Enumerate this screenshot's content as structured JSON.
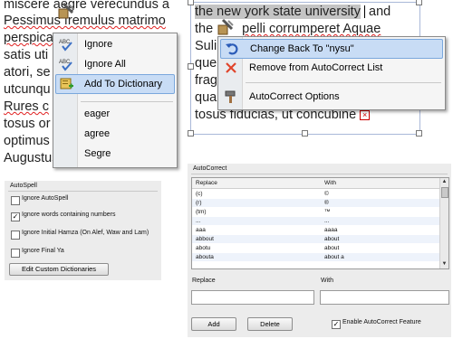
{
  "document_left": {
    "lines": [
      "miscere aegre verecundus a",
      "Pessimus fremulus matrimo",
      "perspica",
      "satis uti",
      "atori, se",
      "utcunqu",
      "Rures c",
      "tosus or",
      "optimus",
      "Augustus"
    ]
  },
  "document_right": {
    "line1": "the new york state university",
    "line1_end": "and",
    "line2": "the",
    "line2_end": "pelli corrumperet Aquae",
    "partial_lines": [
      "Suli",
      "que",
      "frag",
      "qua"
    ],
    "last_line": "tosus fiducias, ut concubine"
  },
  "spell_menu": {
    "items": [
      {
        "label": "Ignore",
        "icon": "abc-check-icon"
      },
      {
        "label": "Ignore All",
        "icon": "abc-check-icon"
      },
      {
        "label": "Add To Dictionary",
        "icon": "add-to-dictionary-icon",
        "selected": true
      }
    ],
    "suggestions": [
      "eager",
      "agree",
      "Segre"
    ]
  },
  "autocorrect_menu": {
    "items": [
      {
        "label": "Change Back To \"nysu\"",
        "icon": "undo-icon",
        "selected": true
      },
      {
        "label": "Remove from AutoCorrect List",
        "icon": "red-x-icon"
      },
      {
        "label": "AutoCorrect Options",
        "icon": "hammer-icon"
      }
    ]
  },
  "autospell_panel": {
    "title": "AutoSpell",
    "options": [
      {
        "label": "Ignore AutoSpell",
        "checked": false
      },
      {
        "label": "Ignore words containing numbers",
        "checked": true
      },
      {
        "label": "Ignore Initial Hamza (On Alef, Waw and Lam)",
        "checked": false
      },
      {
        "label": "Ignore Final Ya",
        "checked": false
      }
    ],
    "edit_button": "Edit Custom Dictionaries"
  },
  "autocorrect_panel": {
    "title": "AutoCorrect",
    "columns": [
      "Replace",
      "With"
    ],
    "rows": [
      [
        "(c)",
        "©"
      ],
      [
        "(r)",
        "®"
      ],
      [
        "(tm)",
        "™"
      ],
      [
        "...",
        "..."
      ],
      [
        "aaa",
        "aaaa"
      ],
      [
        "abbout",
        "about"
      ],
      [
        "abotu",
        "about"
      ],
      [
        "abouta",
        "about a"
      ]
    ],
    "replace_label": "Replace",
    "with_label": "With",
    "replace_value": "",
    "with_value": "",
    "add_button": "Add",
    "delete_button": "Delete",
    "enable_label": "Enable AutoCorrect Feature",
    "enable_checked": true
  }
}
